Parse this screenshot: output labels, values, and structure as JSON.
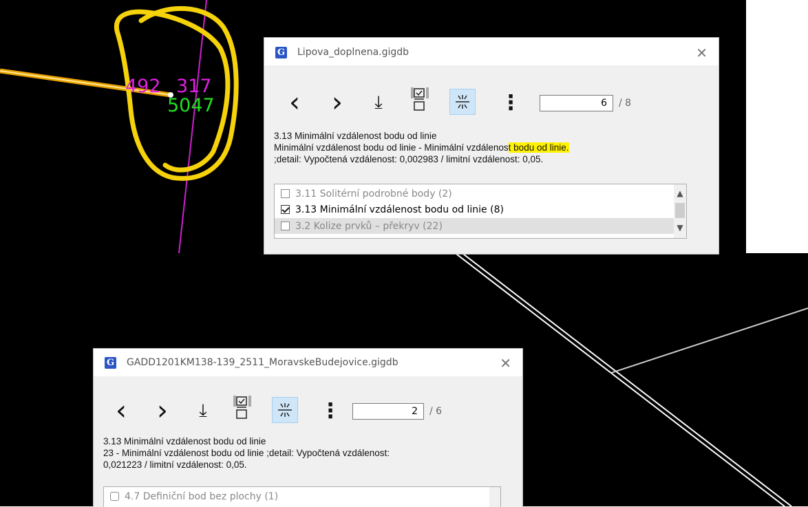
{
  "canvas_labels": {
    "label_a": "492",
    "label_b": "317",
    "label_c": "5047"
  },
  "colors": {
    "annotation_yellow": "#f5d20a",
    "magenta_label": "#e020e0",
    "green_label": "#20e020",
    "highlight": "#fff200"
  },
  "dialog1": {
    "title": "Lipova_doplnena.gigdb",
    "app_icon": "G",
    "close_glyph": "✕",
    "toolbar": {
      "prev_glyph": "‹",
      "next_glyph": "›",
      "download_glyph": "⤓",
      "checklist_icon": "checklist-icon",
      "zoom_icon": "zoom-to-feature-icon",
      "more_glyph": "⋮"
    },
    "page_value": "6",
    "page_total": "/ 8",
    "message": {
      "line1": "3.13 Minimální vzdálenost bodu od linie",
      "line2_plain": "Minimální vzdálenost bodu od linie - Minimální vzdálenos",
      "line2_highlight": "t bodu od linie.",
      "line3": ";detail: Vypočtená vzdálenost: 0,002983 / limitní vzdálenost: 0,05."
    },
    "list": [
      {
        "label": "3.11 Solitérní podrobné body (2)",
        "checked": false
      },
      {
        "label": "3.13 Minimální vzdálenost bodu od linie (8)",
        "checked": true
      },
      {
        "label": "3.2 Kolize prvků – překryv (22)",
        "checked": false
      }
    ]
  },
  "dialog2": {
    "title": "GADD1201KM138-139_2511_MoravskeBudejovice.gigdb",
    "app_icon": "G",
    "close_glyph": "✕",
    "toolbar": {
      "prev_glyph": "‹",
      "next_glyph": "›",
      "download_glyph": "⤓",
      "checklist_icon": "checklist-icon",
      "zoom_icon": "zoom-to-feature-icon",
      "more_glyph": "⋮"
    },
    "page_value": "2",
    "page_total": "/ 6",
    "message": {
      "line1": "3.13 Minimální vzdálenost bodu od linie",
      "line2": "23 - Minimální vzdálenost bodu od linie ;detail: Vypočtená vzdálenost:",
      "line3": "0,021223 / limitní vzdálenost: 0,05."
    },
    "list": [
      {
        "label": "4.7 Definiční bod bez plochy (1)",
        "checked": false
      }
    ]
  }
}
